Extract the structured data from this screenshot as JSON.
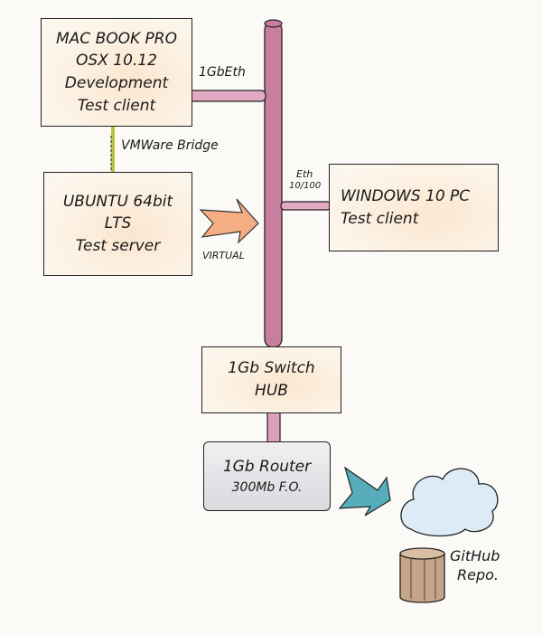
{
  "nodes": {
    "macbook": {
      "lines": [
        "MAC BOOK PRO",
        "OSX 10.12",
        "Development",
        "Test client"
      ]
    },
    "ubuntu": {
      "lines": [
        "UBUNTU 64bit",
        "LTS",
        "Test server"
      ]
    },
    "windows": {
      "lines": [
        "WINDOWS 10 PC",
        "Test client"
      ]
    },
    "switch": {
      "lines": [
        "1Gb Switch",
        "HUB"
      ]
    },
    "router": {
      "lines": [
        "1Gb Router",
        "300Mb F.O."
      ]
    },
    "github": {
      "lines": [
        "GitHub",
        "Repo."
      ]
    }
  },
  "links": {
    "mac_eth": "1GbEth",
    "vmware": "VMWare Bridge",
    "virtual": "VIRTUAL",
    "win_eth_1": "Eth",
    "win_eth_2": "10/100"
  },
  "colors": {
    "backbone": "#b5567f",
    "vmware_link": "#b9c23a",
    "virtual_arrow": "#f3a070",
    "internet_arrow": "#3a9fb0",
    "cloud": "#dcebf5",
    "repo": "#b88e6a",
    "box_fill": "#fbe6cf"
  }
}
